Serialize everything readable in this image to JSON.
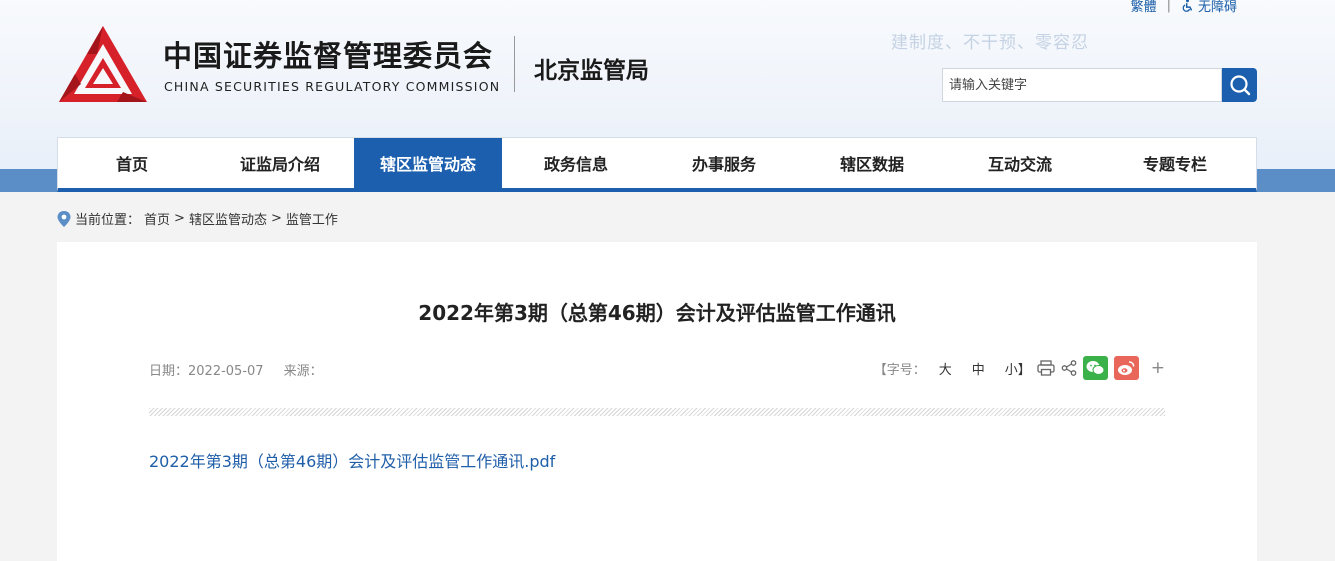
{
  "top_links": {
    "traditional": "繁體",
    "separator": "|",
    "accessibility": "无障碍"
  },
  "header": {
    "title_cn": "中国证券监督管理委员会",
    "title_en": "CHINA SECURITIES REGULATORY COMMISSION",
    "bureau": "北京监管局",
    "slogan": "建制度、不干预、零容忍"
  },
  "search": {
    "placeholder": "请输入关键字"
  },
  "nav": {
    "items": [
      {
        "label": "首页"
      },
      {
        "label": "证监局介绍"
      },
      {
        "label": "辖区监管动态"
      },
      {
        "label": "政务信息"
      },
      {
        "label": "办事服务"
      },
      {
        "label": "辖区数据"
      },
      {
        "label": "互动交流"
      },
      {
        "label": "专题专栏"
      }
    ],
    "active_index": 2
  },
  "breadcrumb": {
    "prefix": "当前位置：",
    "items": [
      "首页",
      "辖区监管动态",
      "监管工作"
    ],
    "separator": ">"
  },
  "article": {
    "title": "2022年第3期（总第46期）会计及评估监管工作通讯",
    "date_label": "日期：",
    "date": "2022-05-07",
    "source_label": "来源：",
    "source": "",
    "font_size_label": "【字号：",
    "font_large": "大",
    "font_medium": "中",
    "font_small": "小】",
    "more": "+",
    "attachment": "2022年第3期（总第46期）会计及评估监管工作通讯.pdf"
  },
  "colors": {
    "brand_blue": "#1b5fae",
    "band_blue": "#5b8ec7",
    "logo_red": "#d7212a",
    "link_blue": "#1f5ea8",
    "wechat_green": "#3bb14a",
    "weibo_red": "#e8675a"
  }
}
